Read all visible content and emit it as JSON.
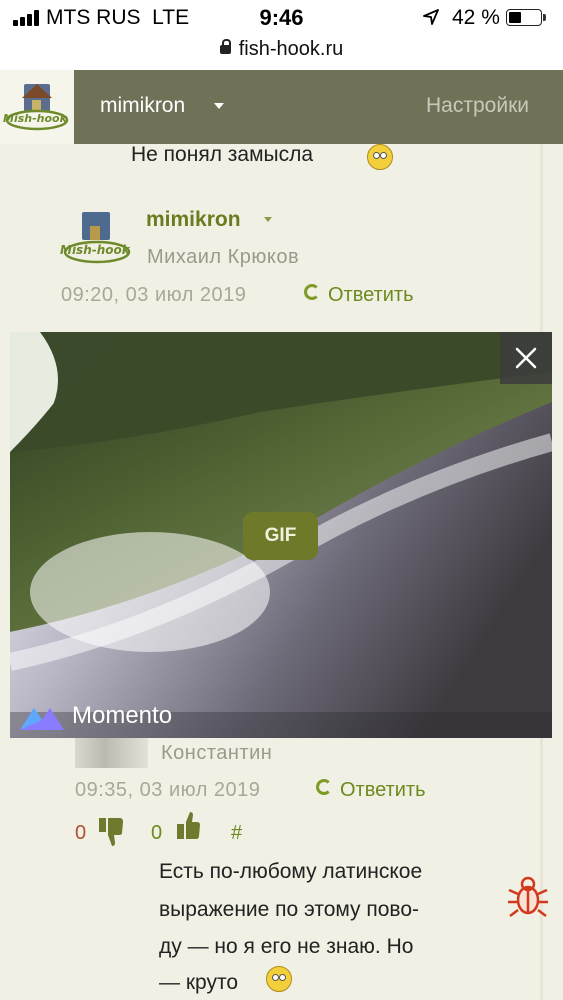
{
  "status_bar": {
    "carrier": "MTS RUS",
    "network": "LTE",
    "time": "9:46",
    "battery_percent": "42 %",
    "battery_level": 0.42
  },
  "browser": {
    "url": "fish-hook.ru"
  },
  "header": {
    "username": "mimikron",
    "settings_label": "Настройки"
  },
  "comments": [
    {
      "text": "Не понял замысла"
    },
    {
      "username": "mimikron",
      "real_name": "Михаил Крюков",
      "datetime": "09:20, 03 июл 2019",
      "reply_label": "Ответить"
    },
    {
      "real_name": "Константин",
      "datetime": "09:35, 03 июл 2019",
      "reply_label": "Ответить",
      "dislikes": "0",
      "likes": "0",
      "permalink": "#",
      "text_lines": [
        "Есть по-любому латинское",
        "выражение по этому пово-",
        "ду — но я его не знаю. Но",
        "— круто"
      ]
    }
  ],
  "overlay": {
    "badge": "GIF",
    "brand": "Momento"
  },
  "colors": {
    "header_bg": "#707257",
    "accent_green": "#6b7b1f",
    "negative_red": "#b24e32",
    "page_bg": "#f1f0e4"
  },
  "icons": [
    "signal-icon",
    "location-arrow-icon",
    "battery-icon",
    "lock-icon",
    "chevron-down-icon",
    "smiley-icon",
    "reply-icon",
    "thumbs-down-icon",
    "thumbs-up-icon",
    "close-icon",
    "momento-logo-icon",
    "bug-icon"
  ]
}
